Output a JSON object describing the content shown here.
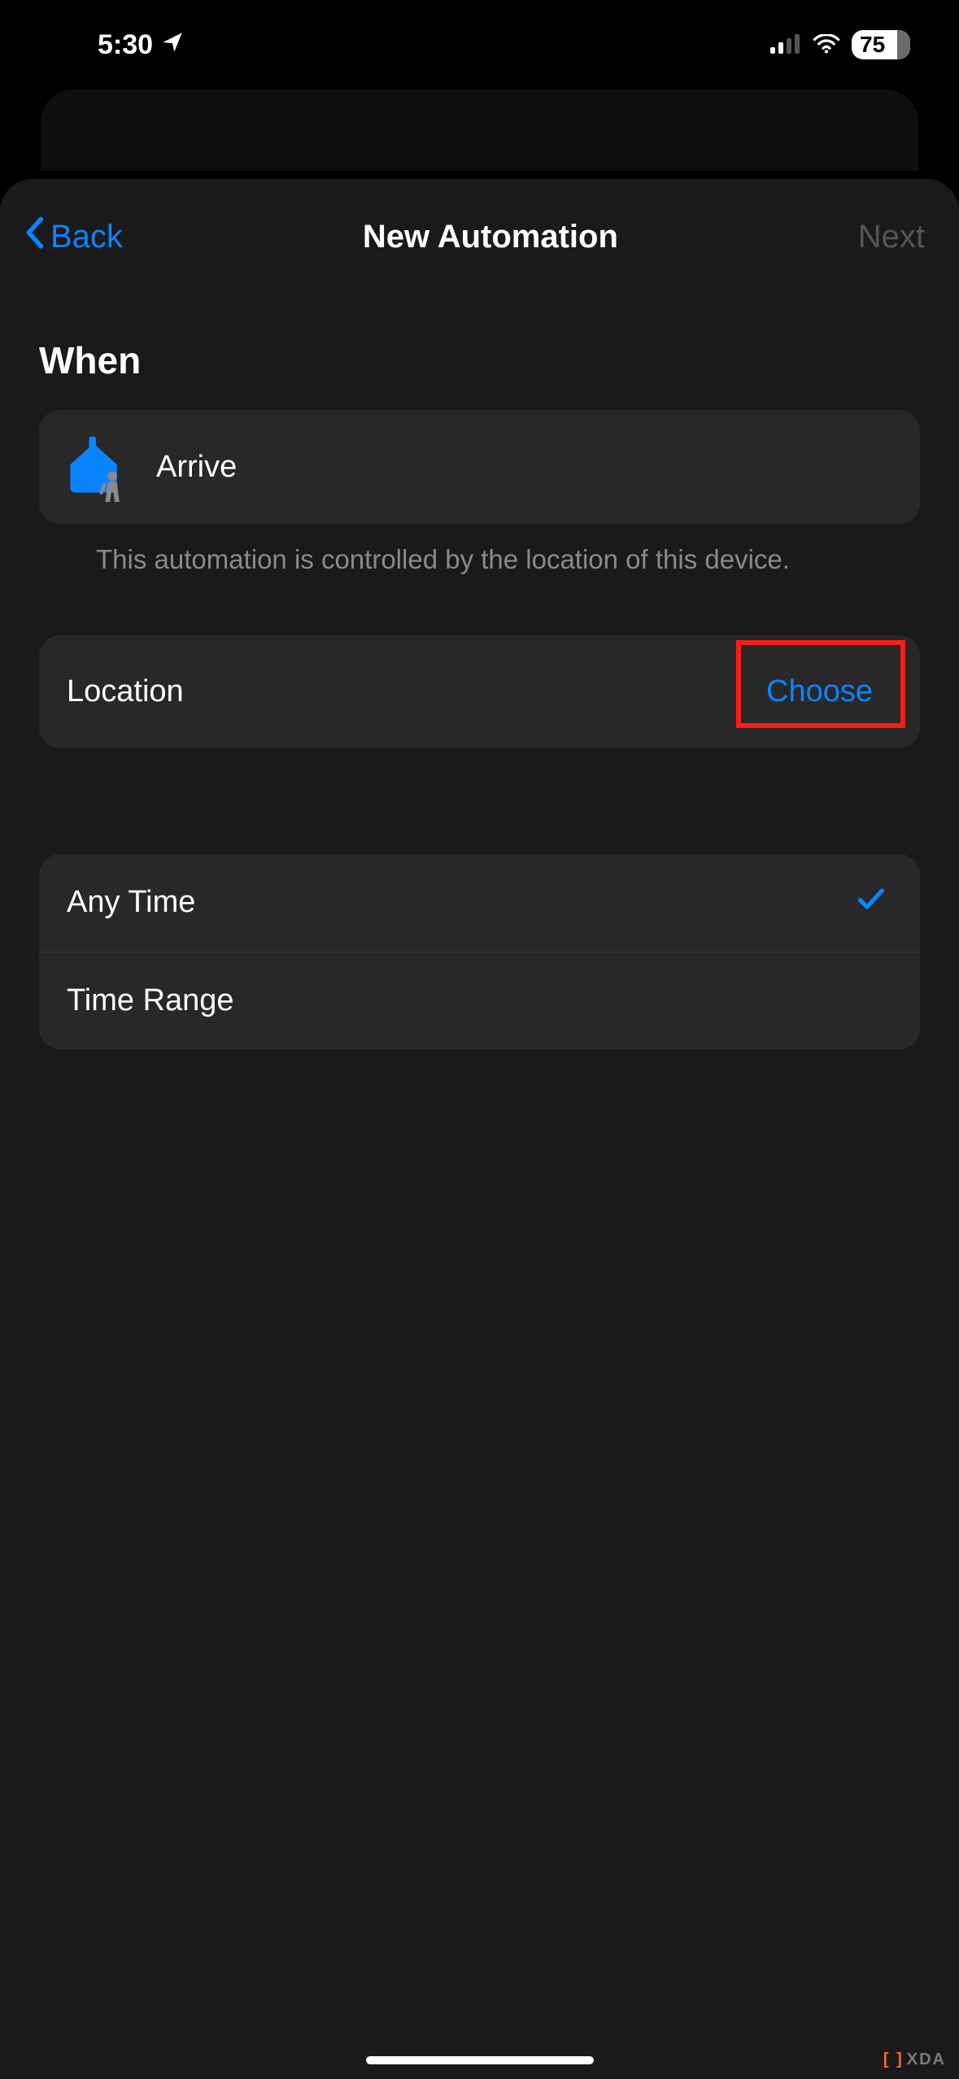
{
  "statusBar": {
    "time": "5:30",
    "battery": "75"
  },
  "nav": {
    "back": "Back",
    "title": "New Automation",
    "next": "Next"
  },
  "section": {
    "when": "When"
  },
  "arrive": {
    "label": "Arrive",
    "footnote": "This automation is controlled by the location of this device."
  },
  "location": {
    "label": "Location",
    "action": "Choose"
  },
  "time": {
    "anyTime": "Any Time",
    "timeRange": "Time Range",
    "selected": "anyTime"
  },
  "watermark": {
    "mark": "[ ]",
    "text": "XDA"
  },
  "colors": {
    "accent": "#0a84ff",
    "highlight": "#ff1a1a"
  }
}
